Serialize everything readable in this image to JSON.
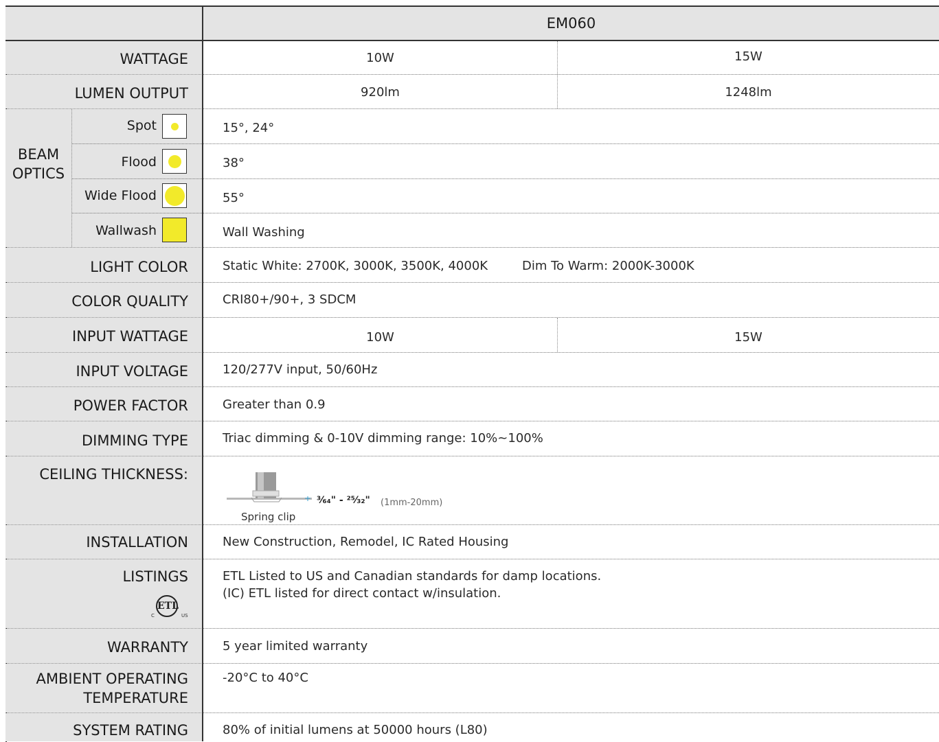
{
  "header": {
    "model": "EM060"
  },
  "rows": {
    "wattage": {
      "label": "WATTAGE",
      "left": "10W",
      "right": "15W"
    },
    "lumen": {
      "label": "LUMEN OUTPUT",
      "left": "920lm",
      "right": "1248lm"
    },
    "beam": {
      "label_line1": "BEAM",
      "label_line2": "OPTICS",
      "options": [
        {
          "label": "Spot",
          "value": "15°, 24°",
          "icon": "small-dot"
        },
        {
          "label": "Flood",
          "value": "38°",
          "icon": "medium-dot"
        },
        {
          "label": "Wide Flood",
          "value": "55°",
          "icon": "large-dot"
        },
        {
          "label": "Wallwash",
          "value": "Wall Washing",
          "icon": "filled-square"
        }
      ]
    },
    "light_color": {
      "label": "LIGHT COLOR",
      "static": "Static White: 2700K, 3000K, 3500K, 4000K",
      "dtw": "Dim To Warm: 2000K-3000K"
    },
    "color_quality": {
      "label": "COLOR QUALITY",
      "value": "CRI80+/90+, 3 SDCM"
    },
    "input_wattage": {
      "label": "INPUT WATTAGE",
      "left": "10W",
      "right": "15W"
    },
    "input_voltage": {
      "label": "INPUT VOLTAGE",
      "value": "120/277V input, 50/60Hz"
    },
    "power_factor": {
      "label": "POWER FACTOR",
      "value": "Greater than 0.9"
    },
    "dimming": {
      "label": "DIMMING TYPE",
      "value": "Triac dimming & 0-10V dimming range: 10%~100%"
    },
    "ceiling": {
      "label": "CEILING THICKNESS:",
      "range": "³⁄₆₄\" - ²⁵⁄₃₂\"",
      "metric": "(1mm-20mm)",
      "caption": "Spring clip"
    },
    "installation": {
      "label": "INSTALLATION",
      "value": "New Construction, Remodel, IC Rated Housing"
    },
    "listings": {
      "label": "LISTINGS",
      "line1": "ETL Listed to US and Canadian standards for damp locations.",
      "line2": "(IC) ETL listed for direct contact w/insulation.",
      "logo": "ETL",
      "logo_c": "C",
      "logo_us": "US"
    },
    "warranty": {
      "label": "WARRANTY",
      "value": "5 year limited warranty"
    },
    "ambient": {
      "label_line1": "AMBIENT OPERATING",
      "label_line2": "TEMPERATURE",
      "value": "-20°C to 40°C"
    },
    "system_rating": {
      "label": "SYSTEM RATING",
      "value": "80% of initial lumens at 50000 hours (L80)"
    }
  },
  "colors": {
    "label_bg": "#e4e4e4",
    "beam_yellow": "#f2ea2a",
    "border": "#333333"
  }
}
